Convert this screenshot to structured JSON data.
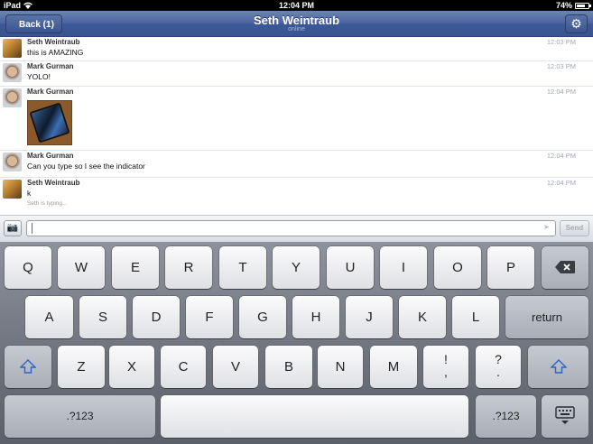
{
  "status_bar": {
    "device": "iPad",
    "time": "12:04 PM",
    "battery": "74%",
    "battery_level": 0.74
  },
  "nav": {
    "back_label": "Back (1)",
    "title": "Seth Weintraub",
    "subtitle": "online",
    "settings_icon": "gear-icon"
  },
  "messages": [
    {
      "sender": "Seth Weintraub",
      "text": "this is AMAZING",
      "time": "12:03 PM",
      "avatar": "seth"
    },
    {
      "sender": "Mark Gurman",
      "text": "YOLO!",
      "time": "12:03 PM",
      "avatar": "mark"
    },
    {
      "sender": "Mark Gurman",
      "text": "",
      "time": "12:04 PM",
      "avatar": "mark",
      "has_photo": true
    },
    {
      "sender": "Mark Gurman",
      "text": "Can you type so I see the indicator",
      "time": "12:04 PM",
      "avatar": "mark"
    },
    {
      "sender": "Seth Weintraub",
      "text": "k",
      "time": "12:04 PM",
      "avatar": "seth"
    }
  ],
  "typing_indicator": "Seth is typing...",
  "composer": {
    "camera_icon": "camera-icon",
    "input_value": "",
    "location_icon": "location-arrow-icon",
    "send_label": "Send"
  },
  "keyboard": {
    "row1": [
      "Q",
      "W",
      "E",
      "R",
      "T",
      "Y",
      "U",
      "I",
      "O",
      "P"
    ],
    "row2": [
      "A",
      "S",
      "D",
      "F",
      "G",
      "H",
      "J",
      "K",
      "L"
    ],
    "row3": [
      "Z",
      "X",
      "C",
      "V",
      "B",
      "N",
      "M"
    ],
    "return_label": "return",
    "exclam_top": "!",
    "exclam_bottom": ",",
    "question_top": "?",
    "question_bottom": ".",
    "numbers_label": ".?123"
  }
}
